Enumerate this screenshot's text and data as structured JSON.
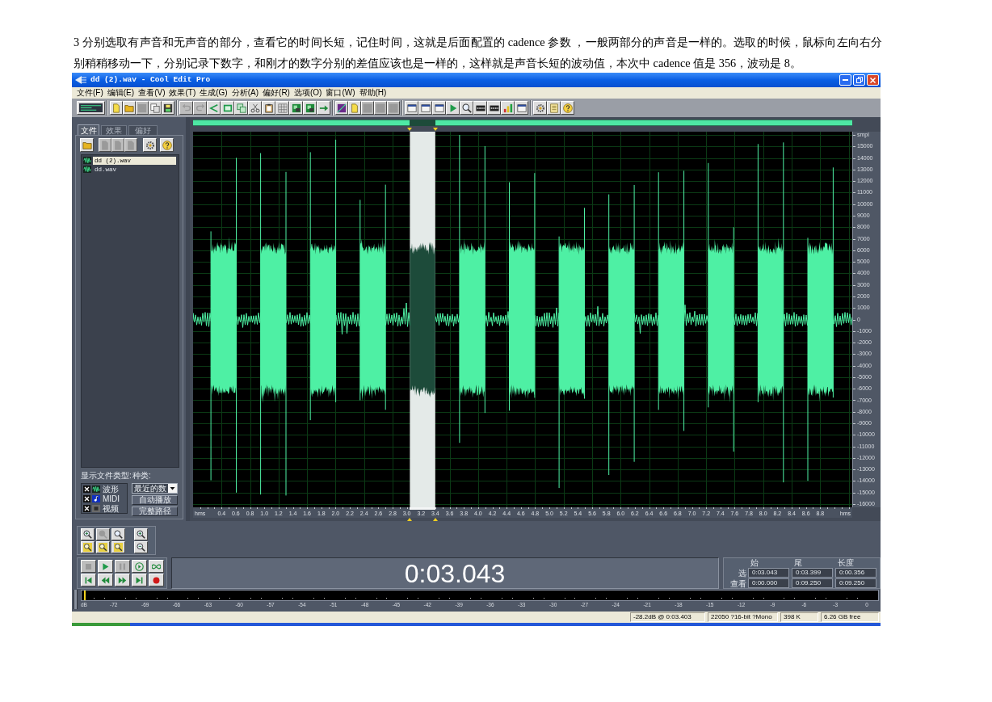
{
  "paragraph": "3 分别选取有声音和无声音的部分，查看它的时间长短，记住时间，这就是后面配置的 cadence 参数 ，一般两部分的声音是一样的。选取的时候，鼠标向左向右分别稍稍移动一下，分别记录下数字，和刚才的数字分别的差值应该也是一样的，这样就是声音长短的波动值，本次中 cadence 值是 356，波动是 8。",
  "window": {
    "title": "dd (2).wav - Cool Edit Pro"
  },
  "menu": [
    "文件(F)",
    "编辑(E)",
    "查看(V)",
    "效果(T)",
    "生成(G)",
    "分析(A)",
    "偏好(R)",
    "选项(O)",
    "窗口(W)",
    "帮助(H)"
  ],
  "toolbar": [
    [
      {
        "disabled": false
      }
    ],
    [
      {
        "disabled": false
      },
      {
        "disabled": false
      },
      {
        "disabled": true
      },
      {
        "disabled": false
      },
      {
        "disabled": false
      }
    ],
    [
      {
        "disabled": true
      },
      {
        "disabled": true
      },
      {
        "disabled": false
      },
      {
        "disabled": false
      },
      {
        "disabled": false
      },
      {
        "disabled": false
      },
      {
        "disabled": false
      },
      {
        "disabled": false
      },
      {
        "disabled": false
      },
      {
        "disabled": false
      },
      {
        "disabled": false
      }
    ],
    [
      {
        "disabled": false
      },
      {
        "disabled": false
      },
      {
        "disabled": true
      },
      {
        "disabled": true
      },
      {
        "disabled": true
      }
    ],
    [
      {
        "disabled": false
      },
      {
        "disabled": false
      },
      {
        "disabled": false
      },
      {
        "disabled": false
      },
      {
        "disabled": false
      },
      {
        "disabled": false
      },
      {
        "disabled": false
      },
      {
        "disabled": false
      },
      {
        "disabled": false
      }
    ],
    [
      {
        "disabled": false
      },
      {
        "disabled": false
      },
      {
        "disabled": false
      }
    ]
  ],
  "organizer": {
    "tabs": [
      {
        "label": "文件",
        "selected": true
      },
      {
        "label": "效果",
        "selected": false
      },
      {
        "label": "偏好",
        "selected": false
      }
    ],
    "buttons": [
      {
        "disabled": false
      },
      {
        "disabled": true
      },
      {
        "disabled": true
      },
      {
        "disabled": true
      },
      {
        "disabled": false
      },
      {
        "disabled": false
      }
    ],
    "files": [
      {
        "name": "dd (2).wav",
        "selected": true
      },
      {
        "name": "dd.wav",
        "selected": false
      }
    ],
    "file_types_label": "显示文件类型:",
    "file_types": [
      {
        "label": "波形",
        "checked": true
      },
      {
        "label": "MIDI",
        "checked": true
      },
      {
        "label": "视频",
        "checked": true
      }
    ],
    "sort_label": "种类:",
    "sort_value": "最近的数",
    "action_buttons": [
      "自动播放",
      "完整路径"
    ]
  },
  "waveform": {
    "bursts": [
      {
        "selected": false
      },
      {
        "selected": false
      },
      {
        "selected": false
      },
      {
        "selected": false
      },
      {
        "selected": true
      },
      {
        "selected": false
      },
      {
        "selected": false
      },
      {
        "selected": false
      },
      {
        "selected": false
      },
      {
        "selected": false
      },
      {
        "selected": false
      },
      {
        "selected": false
      },
      {
        "selected": false
      }
    ],
    "amplitude_labels": [
      "smpl",
      "15000",
      "14000",
      "13000",
      "12000",
      "11000",
      "10000",
      "9000",
      "8000",
      "7000",
      "6000",
      "5000",
      "4000",
      "3000",
      "2000",
      "1000",
      "0",
      "-1000",
      "-2000",
      "-3000",
      "-4000",
      "-5000",
      "-6000",
      "-7000",
      "-8000",
      "-9000",
      "-10000",
      "-11000",
      "-12000",
      "-13000",
      "-14000",
      "-15000",
      "-16000"
    ],
    "time_labels": [
      "hms",
      "0.4",
      "0.6",
      "0.8",
      "1.0",
      "1.2",
      "1.4",
      "1.6",
      "1.8",
      "2.0",
      "2.2",
      "2.4",
      "2.6",
      "2.8",
      "3.0",
      "3.2",
      "3.4",
      "3.6",
      "3.8",
      "4.0",
      "4.2",
      "4.4",
      "4.6",
      "4.8",
      "5.0",
      "5.2",
      "5.4",
      "5.6",
      "5.8",
      "6.0",
      "6.2",
      "6.4",
      "6.6",
      "6.8",
      "7.0",
      "7.2",
      "7.4",
      "7.6",
      "7.8",
      "8.0",
      "8.2",
      "8.4",
      "8.6",
      "8.8",
      "hms"
    ]
  },
  "zoom_buttons": [
    [
      {
        "disabled": false
      },
      {
        "disabled": true
      },
      {
        "disabled": false
      },
      {
        "disabled": false
      }
    ],
    [
      {
        "disabled": false
      },
      {
        "disabled": false
      },
      {
        "disabled": false
      },
      {
        "disabled": false
      }
    ]
  ],
  "transport": [
    [
      {
        "disabled": true
      },
      {
        "disabled": false
      },
      {
        "disabled": true
      },
      {
        "disabled": false
      },
      {
        "disabled": false
      }
    ],
    [
      {
        "disabled": false
      },
      {
        "disabled": false
      },
      {
        "disabled": false
      },
      {
        "disabled": false
      },
      {
        "disabled": false
      }
    ]
  ],
  "time_display": "0:03.043",
  "selection": {
    "columns": [
      "始",
      "尾",
      "长度"
    ],
    "rows": [
      {
        "label": "选",
        "values": [
          "0:03.043",
          "0:03.399",
          "0:00.356"
        ]
      },
      {
        "label": "查看",
        "values": [
          "0:00.000",
          "0:09.250",
          "0:09.250"
        ]
      }
    ]
  },
  "level_meter": {
    "labels": [
      "dB",
      "-72",
      "-69",
      "-66",
      "-63",
      "-60",
      "-57",
      "-54",
      "-51",
      "-48",
      "-45",
      "-42",
      "-39",
      "-36",
      "-33",
      "-30",
      "-27",
      "-24",
      "-21",
      "-18",
      "-15",
      "-12",
      "-9",
      "-6",
      "-3",
      "0"
    ]
  },
  "status_bar": [
    "-28.2dB @ 0:03.403",
    "22050 ?16-bit ?Mono",
    "398 K",
    "6.26 GB free"
  ]
}
